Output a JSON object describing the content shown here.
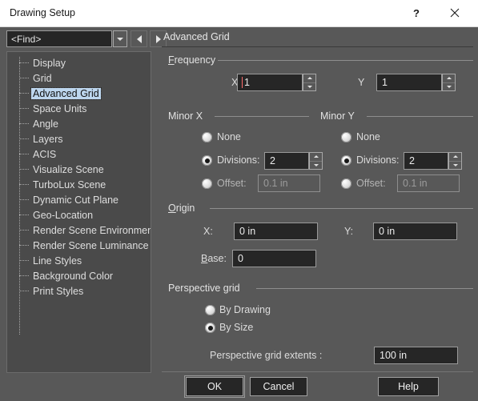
{
  "window": {
    "title": "Drawing Setup",
    "help_icon": "question-mark-icon",
    "close_icon": "close-x-icon"
  },
  "toolbar": {
    "find_value": "<Find>",
    "dropdown_icon": "chevron-down-icon",
    "prev_icon": "triangle-left-icon",
    "next_icon": "triangle-right-icon"
  },
  "tree": {
    "items": [
      {
        "label": "Display",
        "selected": false
      },
      {
        "label": "Grid",
        "selected": false
      },
      {
        "label": "Advanced Grid",
        "selected": true
      },
      {
        "label": "Space Units",
        "selected": false
      },
      {
        "label": "Angle",
        "selected": false
      },
      {
        "label": "Layers",
        "selected": false
      },
      {
        "label": "ACIS",
        "selected": false
      },
      {
        "label": "Visualize Scene",
        "selected": false
      },
      {
        "label": "TurboLux Scene",
        "selected": false
      },
      {
        "label": "Dynamic Cut Plane",
        "selected": false
      },
      {
        "label": "Geo-Location",
        "selected": false
      },
      {
        "label": "Render Scene Environment",
        "selected": false
      },
      {
        "label": "Render Scene Luminance",
        "selected": false
      },
      {
        "label": "Line Styles",
        "selected": false
      },
      {
        "label": "Background Color",
        "selected": false
      },
      {
        "label": "Print Styles",
        "selected": false
      }
    ]
  },
  "panel": {
    "title": "Advanced Grid",
    "frequency": {
      "group_label": "Frequency",
      "x_label": "X",
      "x_value": "1",
      "y_label": "Y",
      "y_value": "1"
    },
    "minor_x": {
      "group_label": "Minor X",
      "none_label": "None",
      "none_selected": false,
      "divisions_label": "Divisions:",
      "divisions_selected": true,
      "divisions_value": "2",
      "offset_label": "Offset:",
      "offset_selected": false,
      "offset_value": "0.1 in"
    },
    "minor_y": {
      "group_label": "Minor Y",
      "none_label": "None",
      "none_selected": false,
      "divisions_label": "Divisions:",
      "divisions_selected": true,
      "divisions_value": "2",
      "offset_label": "Offset:",
      "offset_selected": false,
      "offset_value": "0.1 in"
    },
    "origin": {
      "group_label": "Origin",
      "x_label": "X:",
      "x_value": "0 in",
      "y_label": "Y:",
      "y_value": "0 in",
      "base_label": "Base:",
      "base_value": "0"
    },
    "perspective": {
      "group_label": "Perspective grid",
      "by_drawing_label": "By Drawing",
      "by_drawing_selected": false,
      "by_size_label": "By Size",
      "by_size_selected": true,
      "extents_label": "Perspective grid extents :",
      "extents_value": "100 in"
    }
  },
  "buttons": {
    "ok": "OK",
    "cancel": "Cancel",
    "help": "Help"
  },
  "colors": {
    "dialog_bg": "#585858",
    "tree_bg": "#4a4a4a",
    "input_bg": "#262626",
    "selection": "#bdd6ee",
    "titlebar_bg": "#ffffff"
  }
}
